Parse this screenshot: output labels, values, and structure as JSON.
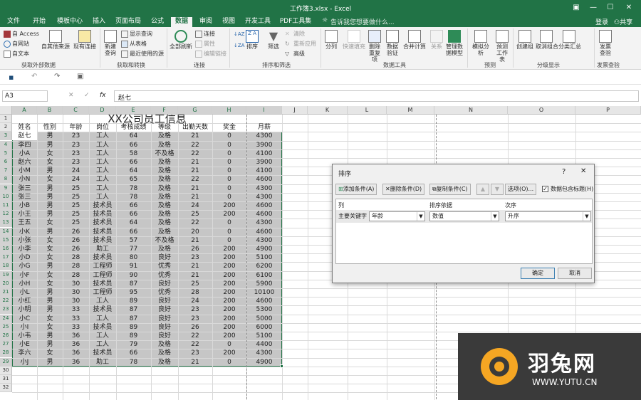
{
  "window": {
    "title": "工作簿3.xlsx - Excel"
  },
  "tabs": [
    "文件",
    "开始",
    "模板中心",
    "插入",
    "页面布局",
    "公式",
    "数据",
    "审阅",
    "视图",
    "开发工具",
    "PDF工具集"
  ],
  "active_tab": "数据",
  "search_placeholder": "告诉我您想要做什么...",
  "login": "登录",
  "share": "共享",
  "ribbon": {
    "access": "自 Access",
    "web": "自网站",
    "text": "自文本",
    "other_sources": "自其他来源",
    "existing_conn": "现有连接",
    "new_query": "新建查询",
    "show_query": "显示查询",
    "from_table": "从表格",
    "recent_sources": "最近使用的源",
    "refresh_all": "全部刷新",
    "connections": "连接",
    "properties": "属性",
    "edit_links": "编辑链接",
    "sort_az": "AZ",
    "sort": "排序",
    "filter": "筛选",
    "clear": "清除",
    "reapply": "重新应用",
    "advanced": "高级",
    "split": "分列",
    "flash_fill": "快速填充",
    "remove_dup": "删除重复项",
    "validation": "数据验证",
    "consolidate": "合并计算",
    "relations": "关系",
    "data_model": "管理数据模型",
    "what_if": "模拟分析",
    "forecast": "预测工作表",
    "group": "创建组",
    "ungroup": "取消组合",
    "subtotal": "分类汇总",
    "publish": "发票查验",
    "groups": {
      "external": "获取外部数据",
      "transform": "获取和转换",
      "conn": "连接",
      "sortfilter": "排序和筛选",
      "tools": "数据工具",
      "forecast": "预测",
      "outline": "分级显示",
      "invoice": "发票查验"
    }
  },
  "formula_bar": {
    "cell_ref": "A3",
    "fx": "fx",
    "value": "赵七"
  },
  "sheet": {
    "columns": [
      "A",
      "B",
      "C",
      "D",
      "E",
      "F",
      "G",
      "H",
      "I",
      "J",
      "K",
      "L",
      "M",
      "N",
      "O",
      "P"
    ],
    "rows": [
      "1",
      "2",
      "3",
      "4",
      "5",
      "6",
      "7",
      "8",
      "9",
      "10",
      "11",
      "12",
      "13",
      "14",
      "15",
      "16",
      "17",
      "18",
      "19",
      "20",
      "21",
      "22",
      "23",
      "24",
      "25",
      "26",
      "27",
      "28",
      "29",
      "30",
      "31",
      "32"
    ],
    "title": "XX公司员工信息",
    "headers": [
      "姓名",
      "性别",
      "年龄",
      "岗位",
      "考核成绩",
      "等级",
      "出勤天数",
      "奖金",
      "月薪"
    ],
    "data": [
      [
        "赵七",
        "男",
        "23",
        "工人",
        "64",
        "及格",
        "21",
        "0",
        "4300"
      ],
      [
        "李四",
        "男",
        "23",
        "工人",
        "66",
        "及格",
        "22",
        "0",
        "3900"
      ],
      [
        "小A",
        "女",
        "23",
        "工人",
        "58",
        "不及格",
        "22",
        "0",
        "4100"
      ],
      [
        "赵六",
        "女",
        "23",
        "工人",
        "66",
        "及格",
        "21",
        "0",
        "3900"
      ],
      [
        "小M",
        "男",
        "24",
        "工人",
        "64",
        "及格",
        "21",
        "0",
        "4100"
      ],
      [
        "小N",
        "女",
        "24",
        "工人",
        "65",
        "及格",
        "22",
        "0",
        "4600"
      ],
      [
        "张三",
        "男",
        "25",
        "工人",
        "78",
        "及格",
        "21",
        "0",
        "4300"
      ],
      [
        "张三",
        "男",
        "25",
        "工人",
        "78",
        "及格",
        "21",
        "0",
        "4300"
      ],
      [
        "小B",
        "男",
        "25",
        "技术员",
        "66",
        "及格",
        "24",
        "200",
        "4600"
      ],
      [
        "小王",
        "男",
        "25",
        "技术员",
        "66",
        "及格",
        "25",
        "200",
        "4600"
      ],
      [
        "王五",
        "女",
        "25",
        "技术员",
        "64",
        "及格",
        "22",
        "0",
        "4300"
      ],
      [
        "小K",
        "男",
        "26",
        "技术员",
        "66",
        "及格",
        "20",
        "0",
        "4600"
      ],
      [
        "小张",
        "女",
        "26",
        "技术员",
        "57",
        "不及格",
        "21",
        "0",
        "4300"
      ],
      [
        "小李",
        "女",
        "26",
        "助工",
        "77",
        "及格",
        "26",
        "200",
        "4900"
      ],
      [
        "小D",
        "女",
        "28",
        "技术员",
        "80",
        "良好",
        "23",
        "200",
        "5100"
      ],
      [
        "小G",
        "男",
        "28",
        "工程师",
        "91",
        "优秀",
        "21",
        "200",
        "6200"
      ],
      [
        "小F",
        "女",
        "28",
        "工程师",
        "90",
        "优秀",
        "21",
        "200",
        "6100"
      ],
      [
        "小H",
        "女",
        "30",
        "技术员",
        "87",
        "良好",
        "25",
        "200",
        "5900"
      ],
      [
        "小L",
        "男",
        "30",
        "工程师",
        "95",
        "优秀",
        "28",
        "200",
        "10100"
      ],
      [
        "小红",
        "男",
        "30",
        "工人",
        "89",
        "良好",
        "24",
        "200",
        "4600"
      ],
      [
        "小明",
        "男",
        "33",
        "技术员",
        "87",
        "良好",
        "23",
        "200",
        "5300"
      ],
      [
        "小C",
        "女",
        "33",
        "工人",
        "87",
        "良好",
        "23",
        "200",
        "5000"
      ],
      [
        "小I",
        "女",
        "33",
        "技术员",
        "89",
        "良好",
        "26",
        "200",
        "6000"
      ],
      [
        "小韦",
        "男",
        "36",
        "工人",
        "89",
        "良好",
        "22",
        "200",
        "5100"
      ],
      [
        "小E",
        "男",
        "36",
        "工人",
        "79",
        "及格",
        "22",
        "0",
        "4400"
      ],
      [
        "李六",
        "女",
        "36",
        "技术员",
        "66",
        "及格",
        "23",
        "200",
        "4300"
      ],
      [
        "小J",
        "男",
        "36",
        "助工",
        "78",
        "及格",
        "21",
        "0",
        "4900"
      ]
    ]
  },
  "dialog": {
    "title": "排序",
    "help": "?",
    "close": "✕",
    "add_level": "添加条件(A)",
    "delete_level": "删除条件(D)",
    "copy_level": "复制条件(C)",
    "options": "选项(O)...",
    "has_header": "数据包含标题(H)",
    "col_header": "列",
    "sorton_header": "排序依据",
    "order_header": "次序",
    "primary_key": "主要关键字",
    "column_value": "年龄",
    "sorton_value": "数值",
    "order_value": "升序",
    "ok": "确定",
    "cancel": "取消"
  },
  "watermark": {
    "brand": "羽兔网",
    "url": "WWW.YUTU.CN"
  },
  "colors": {
    "excel_green": "#217346",
    "selection": "#c6c6c6"
  }
}
